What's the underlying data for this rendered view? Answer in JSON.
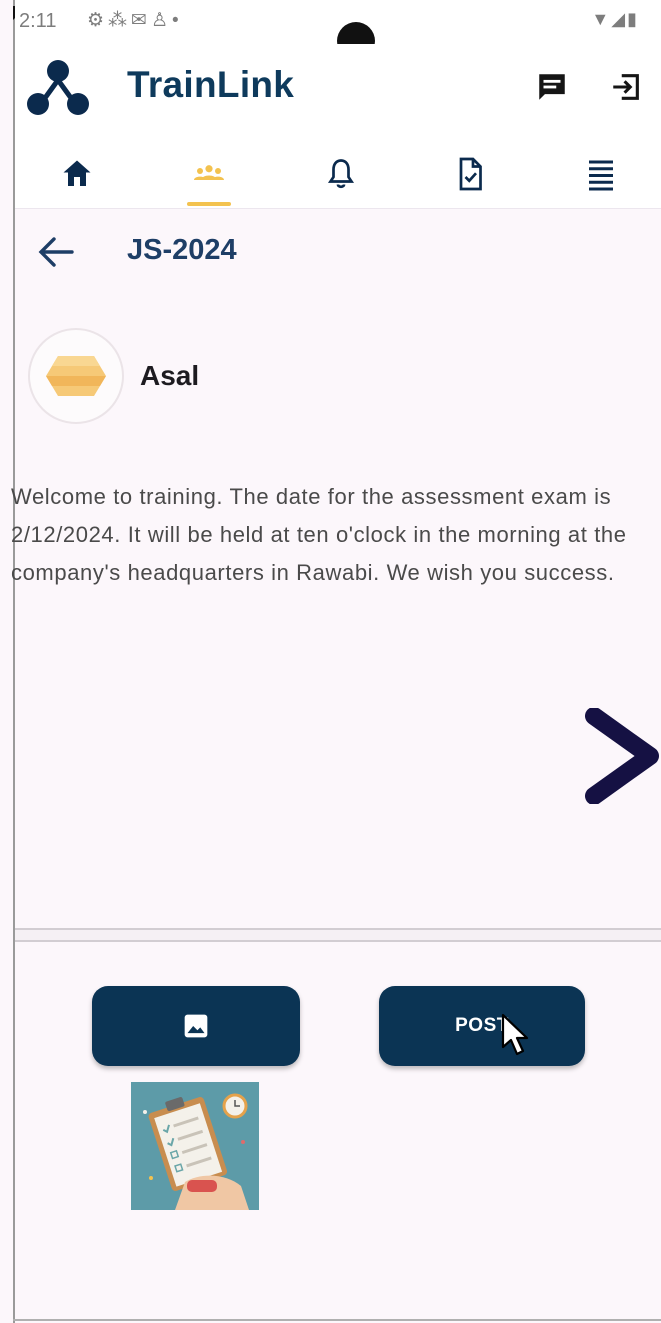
{
  "status_bar": {
    "time": "2:11",
    "left_icons": [
      "gear-icon",
      "fan-icon",
      "mail-icon",
      "person-icon",
      "dot-icon"
    ],
    "right_icons": [
      "wifi-icon",
      "signal-icon",
      "battery-icon"
    ]
  },
  "app": {
    "title": "TrainLink",
    "brand_color": "#0e3a5c",
    "accent_color": "#f3c24f"
  },
  "nav": {
    "tabs": [
      {
        "name": "home-icon",
        "active": false
      },
      {
        "name": "group-icon",
        "active": true
      },
      {
        "name": "bell-icon",
        "active": false
      },
      {
        "name": "document-check-icon",
        "active": false
      },
      {
        "name": "menu-lines-icon",
        "active": false
      }
    ]
  },
  "header": {
    "group_code": "JS-2024"
  },
  "post": {
    "author": "Asal",
    "message": "Welcome to training. The date for the assessment exam is 2/12/2024. It will be held at ten o'clock in the morning at the company's headquarters in Rawabi. We wish you success."
  },
  "actions": {
    "image_button_icon": "image-icon",
    "post_label": "POST",
    "button_color": "#0b3454"
  }
}
